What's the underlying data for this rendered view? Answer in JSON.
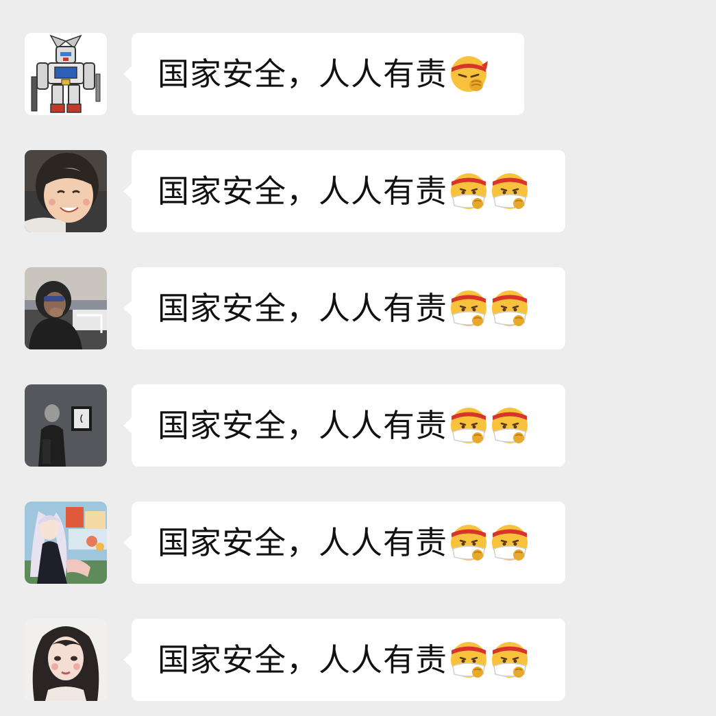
{
  "messages": [
    {
      "sender_avatar": "robot-avatar",
      "text": "国家安全，人人有责",
      "emoji": [
        "determined-face-icon"
      ]
    },
    {
      "sender_avatar": "child-avatar",
      "text": "国家安全，人人有责",
      "emoji": [
        "masked-headband-face-icon",
        "masked-headband-face-icon"
      ]
    },
    {
      "sender_avatar": "hooded-person-avatar",
      "text": "国家安全，人人有责",
      "emoji": [
        "masked-headband-face-icon",
        "masked-headband-face-icon"
      ]
    },
    {
      "sender_avatar": "gallery-person-avatar",
      "text": "国家安全，人人有责",
      "emoji": [
        "masked-headband-face-icon",
        "masked-headband-face-icon"
      ]
    },
    {
      "sender_avatar": "anime-girl-avatar",
      "text": "国家安全，人人有责",
      "emoji": [
        "masked-headband-face-icon",
        "masked-headband-face-icon"
      ]
    },
    {
      "sender_avatar": "drawn-girl-avatar",
      "text": "国家安全，人人有责",
      "emoji": [
        "masked-headband-face-icon",
        "masked-headband-face-icon"
      ]
    }
  ],
  "colors": {
    "background": "#ededed",
    "bubble": "#ffffff",
    "text": "#111111",
    "emoji_face": "#f9c23c",
    "headband": "#d9342b",
    "mask": "#ffffff"
  }
}
